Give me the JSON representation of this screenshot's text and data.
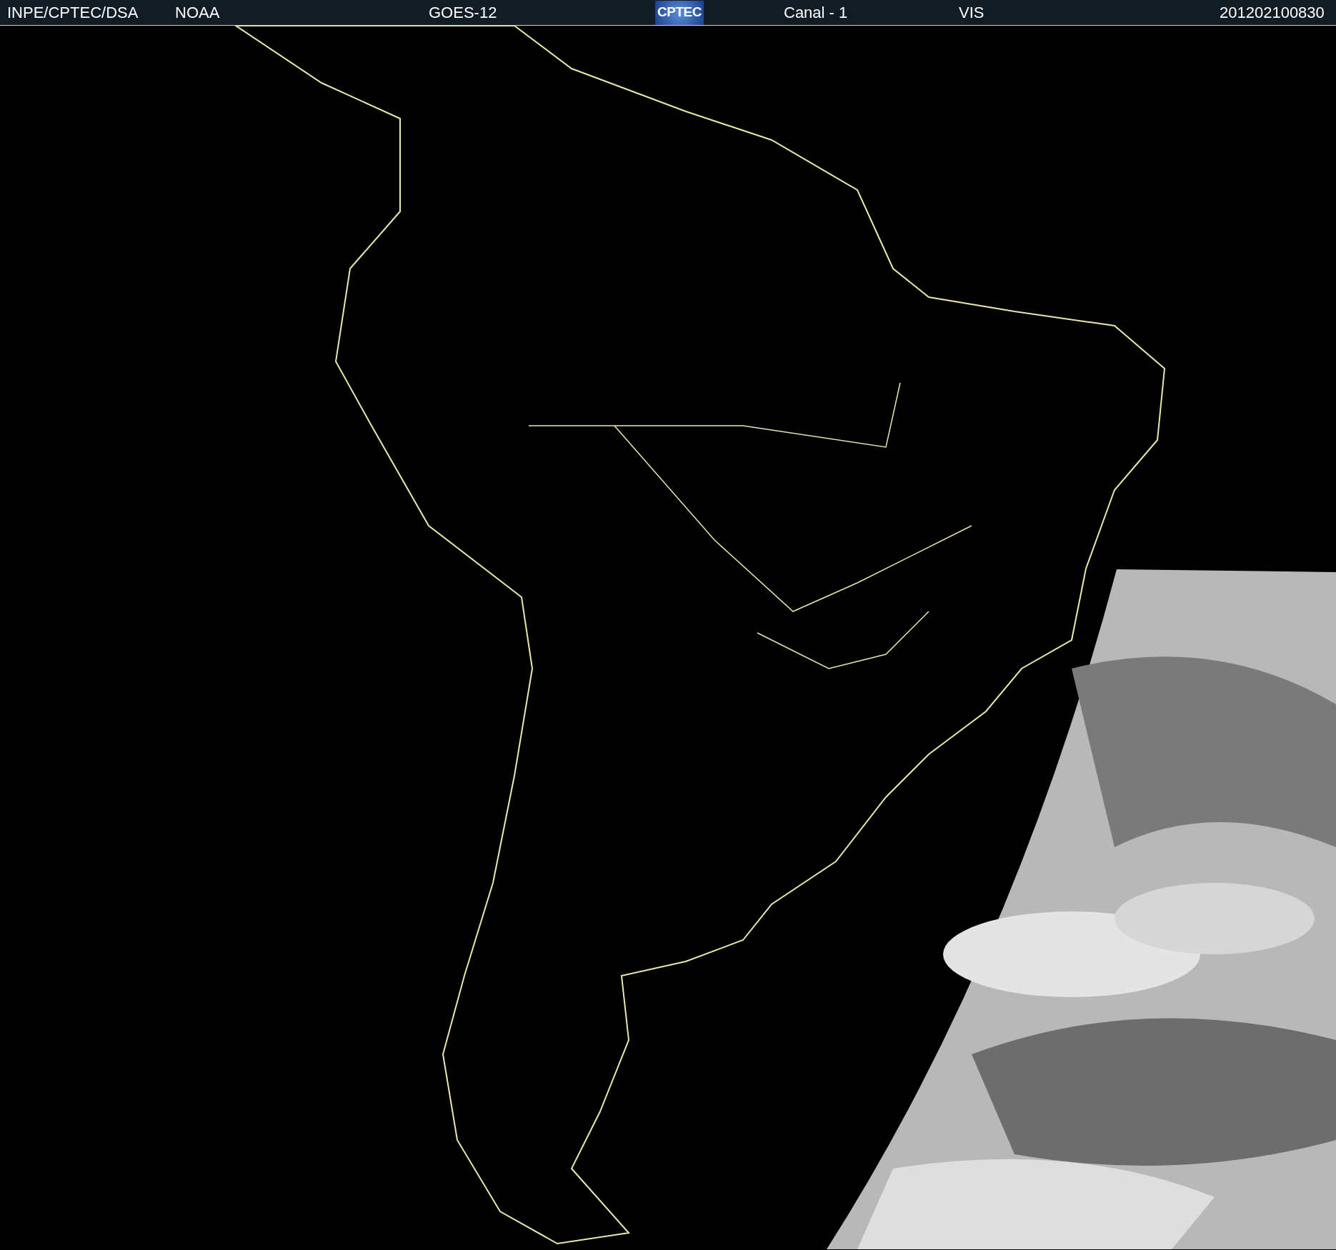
{
  "header": {
    "source": "INPE/CPTEC/DSA",
    "agency": "NOAA",
    "satellite": "GOES-12",
    "logo": "CPTEC",
    "channel": "Canal - 1",
    "band": "VIS",
    "timestamp": "201202100830"
  }
}
